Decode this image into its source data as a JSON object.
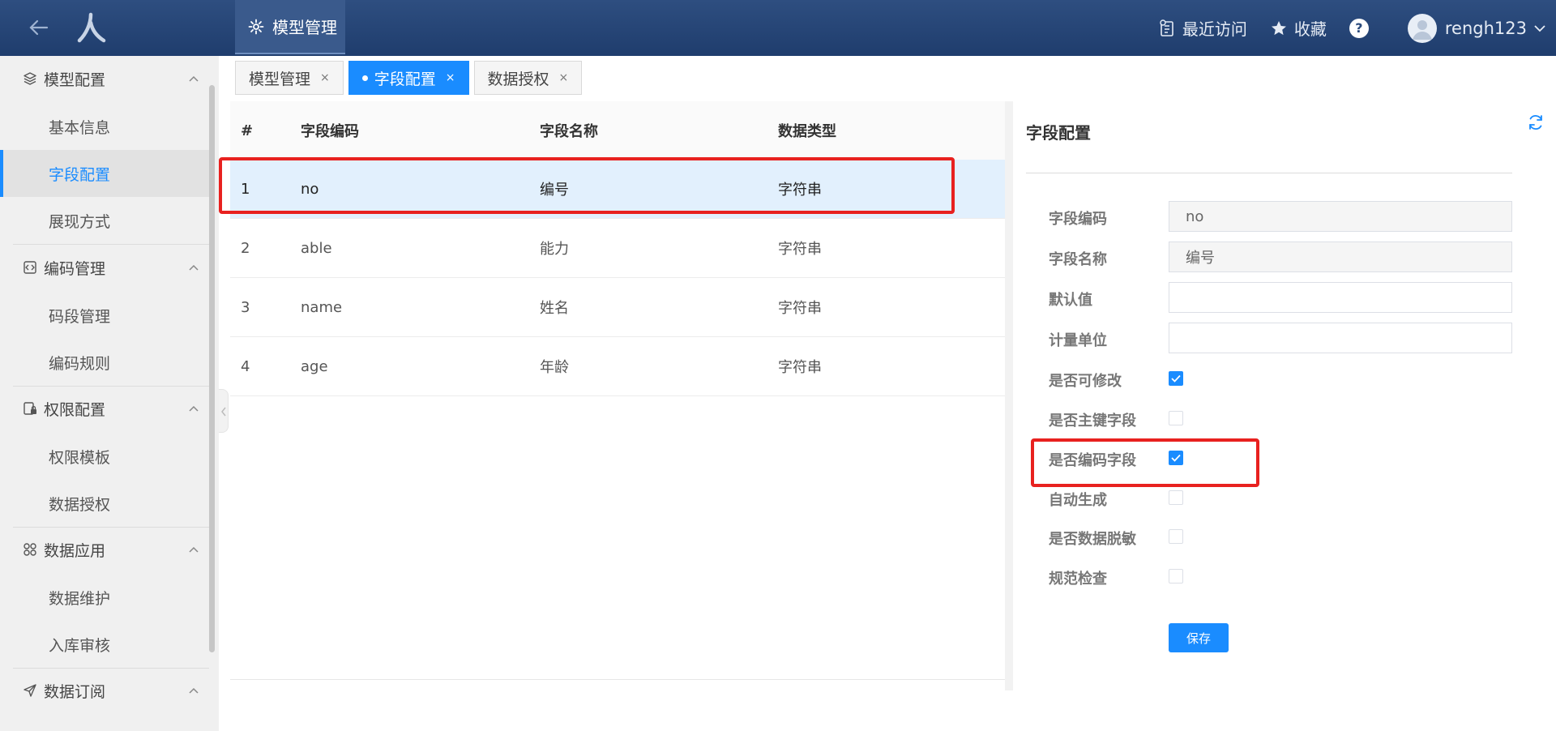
{
  "header": {
    "nav_active": "模型管理",
    "recent": "最近访问",
    "favorites": "收藏",
    "help": "?",
    "username": "rengh123"
  },
  "sidebar": {
    "groups": [
      {
        "label": "模型配置",
        "icon": "layers-icon",
        "items": [
          "基本信息",
          "字段配置",
          "展现方式"
        ]
      },
      {
        "label": "编码管理",
        "icon": "code-icon",
        "items": [
          "码段管理",
          "编码规则"
        ]
      },
      {
        "label": "权限配置",
        "icon": "lock-doc-icon",
        "items": [
          "权限模板",
          "数据授权"
        ]
      },
      {
        "label": "数据应用",
        "icon": "grid-icon",
        "items": [
          "数据维护",
          "入库审核"
        ]
      },
      {
        "label": "数据订阅",
        "icon": "send-icon",
        "items": []
      }
    ],
    "active_item": "字段配置"
  },
  "tabs": [
    {
      "label": "模型管理",
      "active": false
    },
    {
      "label": "字段配置",
      "active": true
    },
    {
      "label": "数据授权",
      "active": false
    }
  ],
  "tab_close": "×",
  "table": {
    "columns": [
      "#",
      "字段编码",
      "字段名称",
      "数据类型"
    ],
    "rows": [
      [
        "1",
        "no",
        "编号",
        "字符串"
      ],
      [
        "2",
        "able",
        "能力",
        "字符串"
      ],
      [
        "3",
        "name",
        "姓名",
        "字符串"
      ],
      [
        "4",
        "age",
        "年龄",
        "字符串"
      ]
    ],
    "selected_row": 0
  },
  "panel": {
    "title": "字段配置",
    "fields": [
      {
        "label": "字段编码",
        "value": "no",
        "disabled": true
      },
      {
        "label": "字段名称",
        "value": "编号",
        "disabled": true
      },
      {
        "label": "默认值",
        "value": "",
        "disabled": false
      },
      {
        "label": "计量单位",
        "value": "",
        "disabled": false
      }
    ],
    "checks": [
      {
        "label": "是否可修改",
        "checked": true
      },
      {
        "label": "是否主键字段",
        "checked": false
      },
      {
        "label": "是否编码字段",
        "checked": true
      },
      {
        "label": "自动生成",
        "checked": false
      },
      {
        "label": "是否数据脱敏",
        "checked": false
      },
      {
        "label": "规范检查",
        "checked": false
      }
    ],
    "save_label": "保存"
  },
  "colors": {
    "accent": "#1a8cff",
    "header": "#2a4a7c",
    "highlight": "#e8211f",
    "selected_row": "#e2f0fd"
  }
}
